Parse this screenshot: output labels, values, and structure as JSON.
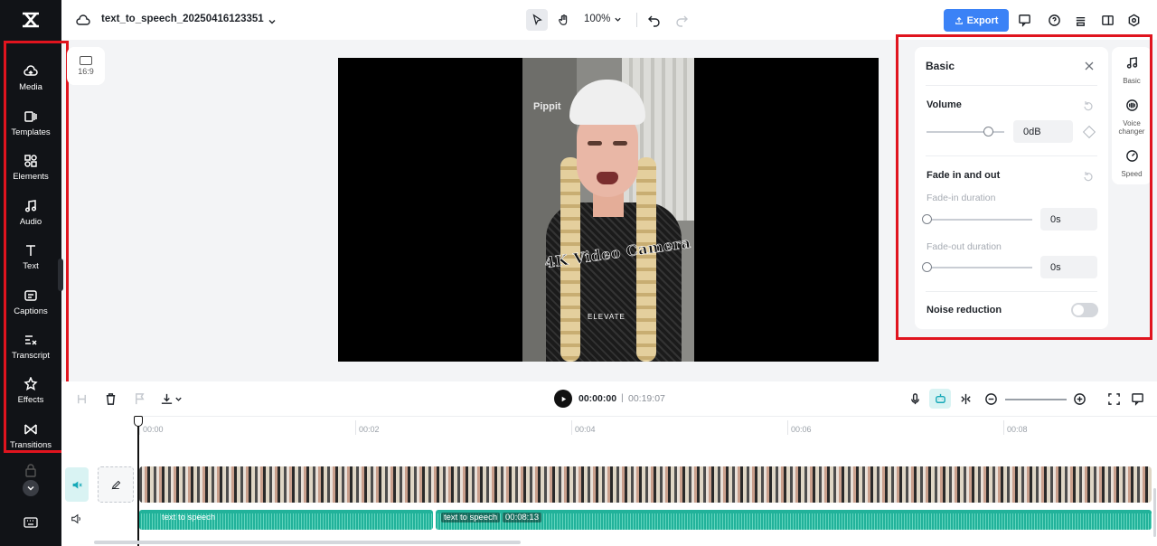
{
  "sidebar": {
    "logo": "capcut-logo-icon",
    "items": [
      {
        "label": "Media",
        "icon": "cloud-upload-icon"
      },
      {
        "label": "Templates",
        "icon": "templates-icon"
      },
      {
        "label": "Elements",
        "icon": "elements-icon"
      },
      {
        "label": "Audio",
        "icon": "music-note-icon"
      },
      {
        "label": "Text",
        "icon": "text-icon"
      },
      {
        "label": "Captions",
        "icon": "captions-icon"
      },
      {
        "label": "Transcript",
        "icon": "transcript-icon"
      },
      {
        "label": "Effects",
        "icon": "effects-icon"
      },
      {
        "label": "Transitions",
        "icon": "transitions-icon"
      }
    ]
  },
  "topbar": {
    "project_name": "text_to_speech_20250416123351",
    "zoom": "100%",
    "export_label": "Export"
  },
  "canvas": {
    "ratio_label": "16:9",
    "video_watermark": "Pippit",
    "video_overlay_text": "4K Video Camera",
    "video_brand_text": "ELEVATE"
  },
  "panel": {
    "title": "Basic",
    "volume_label": "Volume",
    "volume_value": "0dB",
    "volume_level": 0.8,
    "fade_label": "Fade in and out",
    "fade_in_label": "Fade-in duration",
    "fade_in_value": "0s",
    "fade_out_label": "Fade-out duration",
    "fade_out_value": "0s",
    "noise_label": "Noise reduction",
    "noise_enabled": false
  },
  "tabs": [
    {
      "label": "Basic",
      "icon": "music-note-icon"
    },
    {
      "label": "Voice changer",
      "icon": "voice-changer-icon"
    },
    {
      "label": "Speed",
      "icon": "speed-icon"
    }
  ],
  "timeline": {
    "time_current": "00:00:00",
    "time_separator": "|",
    "time_total": "00:19:07",
    "ruler": [
      "00:00",
      "00:02",
      "00:04",
      "00:06",
      "00:08"
    ],
    "audio_clips": [
      {
        "label": "text to speech"
      },
      {
        "label": "text to speech",
        "duration": "00:08:13"
      }
    ]
  }
}
